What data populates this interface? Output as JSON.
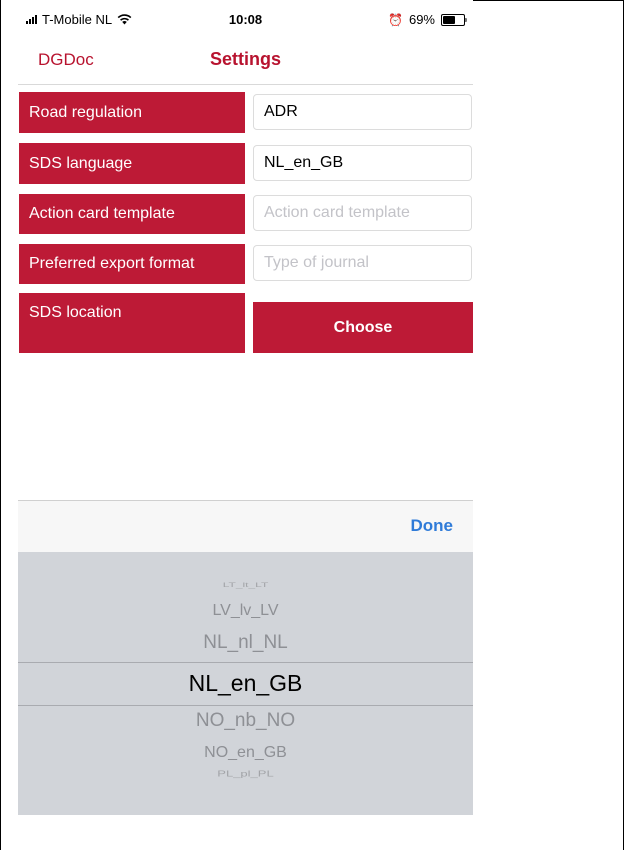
{
  "status_bar": {
    "carrier": "T-Mobile NL",
    "time": "10:08",
    "battery_percent": "69%",
    "battery_level": 0.69,
    "icons": [
      "signal-icon",
      "wifi-icon",
      "alarm-icon",
      "battery-icon"
    ]
  },
  "nav": {
    "back_label": "DGDoc",
    "title": "Settings"
  },
  "settings": {
    "road_regulation": {
      "label": "Road regulation",
      "value": "ADR"
    },
    "sds_language": {
      "label": "SDS language",
      "value": "NL_en_GB"
    },
    "action_card_template": {
      "label": "Action card template",
      "placeholder": "Action card template"
    },
    "export_format": {
      "label": "Preferred export format",
      "placeholder": "Type of journal"
    },
    "sds_location": {
      "label": "SDS location",
      "button": "Choose"
    }
  },
  "picker": {
    "done_label": "Done",
    "items": [
      "LT_lt_LT",
      "LV_lv_LV",
      "NL_nl_NL",
      "NL_en_GB",
      "NO_nb_NO",
      "NO_en_GB",
      "PL_pl_PL"
    ],
    "selected": "NL_en_GB"
  },
  "colors": {
    "accent_red": "#bd1a36",
    "done_blue": "#2f7bd8",
    "picker_background": "#d1d4d9"
  }
}
